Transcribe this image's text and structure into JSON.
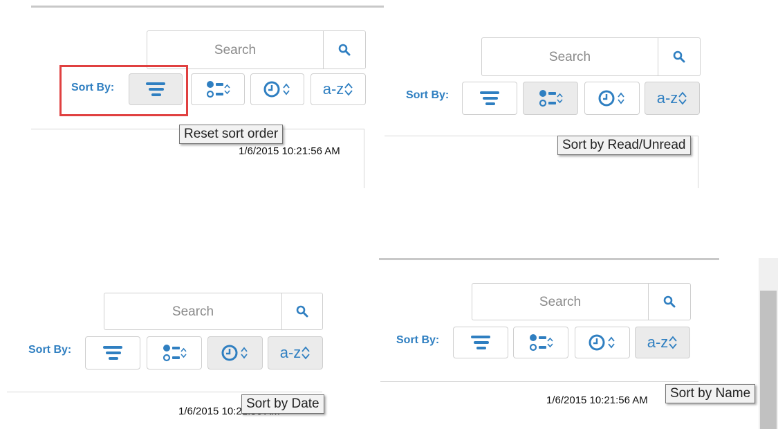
{
  "colors": {
    "accent": "#2f7fc1",
    "highlight": "#e04040",
    "active_button": "#ebebeb"
  },
  "panels": [
    {
      "search_placeholder": "Search",
      "sort_label": "Sort By:",
      "tooltip": "Reset sort order",
      "timestamp": "1/6/2015 10:21:56 AM",
      "active": "reset",
      "highlighted": "reset"
    },
    {
      "search_placeholder": "Search",
      "sort_label": "Sort By:",
      "tooltip": "Sort by Read/Unread",
      "timestamp": "",
      "active": "read",
      "highlighted": ""
    },
    {
      "search_placeholder": "Search",
      "sort_label": "Sort By:",
      "tooltip": "Sort by Date",
      "timestamp": "1/6/2015 10:21:56 AM",
      "active": "date",
      "highlighted": ""
    },
    {
      "search_placeholder": "Search",
      "sort_label": "Sort By:",
      "tooltip": "Sort by Name",
      "timestamp": "1/6/2015 10:21:56 AM",
      "active": "name",
      "highlighted": ""
    }
  ],
  "buttons": {
    "name_label": "a-z"
  },
  "icons": {
    "search": "search-icon",
    "reset": "reset-sort-icon",
    "read": "read-unread-icon",
    "date": "clock-icon",
    "sort_toggle": "sort-arrows-icon"
  }
}
